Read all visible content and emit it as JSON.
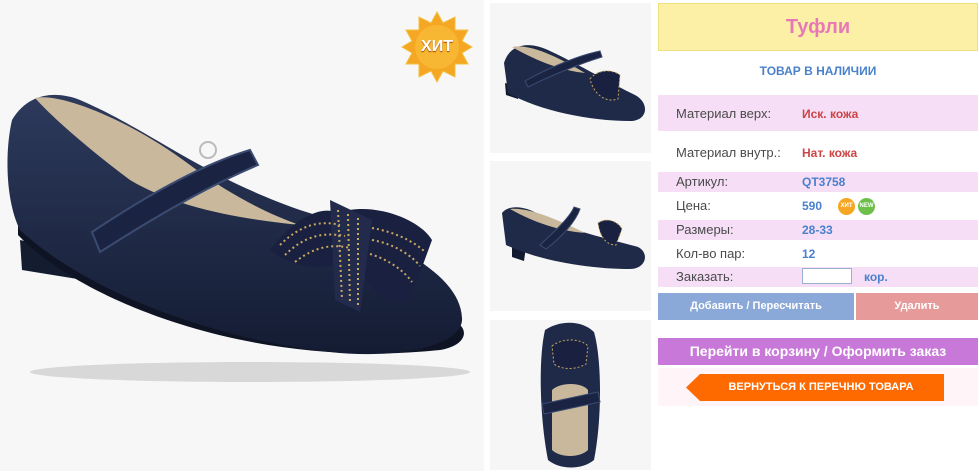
{
  "product": {
    "title": "Туфли",
    "stock_status": "ТОВАР В НАЛИЧИИ",
    "hit_badge": "ХИТ"
  },
  "attributes": [
    {
      "label": "Материал верх:",
      "value": "Иск. кожа"
    },
    {
      "label": "Материал внутр.:",
      "value": "Нат. кожа"
    },
    {
      "label": "Артикул:",
      "value": "QT3758"
    },
    {
      "label": "Цена:",
      "value": "590"
    },
    {
      "label": "Размеры:",
      "value": "28-33"
    },
    {
      "label": "Кол-во пар:",
      "value": "12"
    }
  ],
  "price_badges": {
    "hit": "ХИТ",
    "new": "NEW"
  },
  "order": {
    "label": "Заказать:",
    "value": "",
    "unit": "кор."
  },
  "buttons": {
    "add": "Добавить / Пересчитать",
    "delete": "Удалить",
    "cart": "Перейти в корзину / Оформить заказ",
    "back": "ВЕРНУТЬСЯ К ПЕРЕЧНЮ ТОВАРА"
  },
  "colors": {
    "title_bg": "#fbf0a6",
    "title_text": "#e878b8",
    "row_pink": "#f6def6",
    "add_button": "#8aa8d8",
    "delete_button": "#e69a9a",
    "cart_bar": "#c878d8",
    "back_button": "#ff6a00",
    "shoe": "#1e2a48"
  }
}
